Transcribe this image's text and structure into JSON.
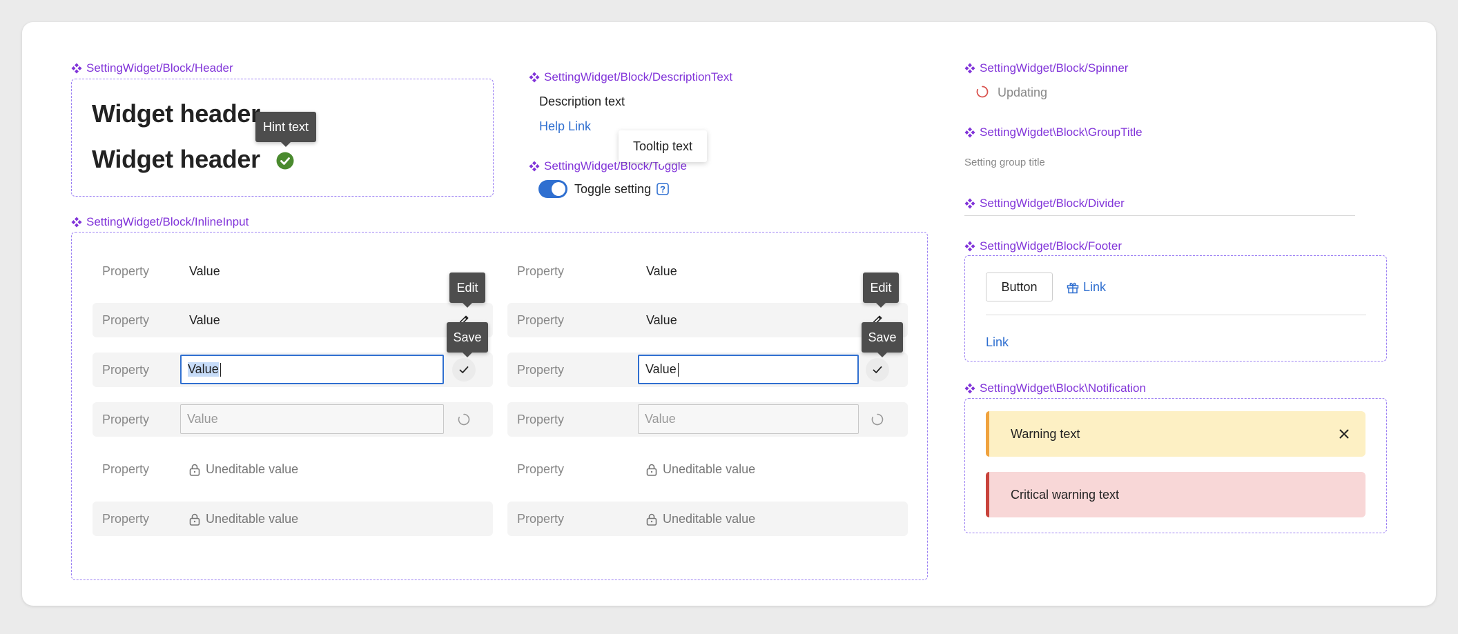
{
  "colors": {
    "component_label": "#8134d9",
    "dashed_border": "#9b7ff3",
    "accent_blue": "#2f6fd0",
    "success_green": "#4a8a2e",
    "warning_bg": "#fdf0c4",
    "warning_bar": "#f0a23d",
    "critical_bg": "#f8d7d7",
    "critical_bar": "#c8423b",
    "spinner_red": "#d9534f"
  },
  "header_block": {
    "component_label": "SettingWidget/Block/Header",
    "title_1": "Widget header",
    "title_2": "Widget header",
    "hint_tooltip": "Hint text",
    "status_icon": "check-circle-icon"
  },
  "description_block": {
    "component_label": "SettingWidget/Block/DescriptionText",
    "description": "Description text",
    "help_link": "Help Link"
  },
  "toggle_block": {
    "component_label": "SettingWidget/Block/Toggle",
    "tooltip": "Tooltip text",
    "label": "Toggle setting",
    "help_icon": "question-icon",
    "enabled": true
  },
  "inline_input": {
    "component_label": "SettingWidget/Block/InlineInput",
    "edit_tooltip": "Edit",
    "save_tooltip": "Save",
    "columns": [
      {
        "rows": [
          {
            "property": "Property",
            "value": "Value",
            "state": "static"
          },
          {
            "property": "Property",
            "value": "Value",
            "state": "hover"
          },
          {
            "property": "Property",
            "value": "Value",
            "state": "editing"
          },
          {
            "property": "Property",
            "value": "Value",
            "state": "saving"
          },
          {
            "property": "Property",
            "value": "Uneditable value",
            "state": "locked"
          },
          {
            "property": "Property",
            "value": "Uneditable value",
            "state": "locked-hover"
          }
        ]
      },
      {
        "rows": [
          {
            "property": "Property",
            "value": "Value",
            "state": "static"
          },
          {
            "property": "Property",
            "value": "Value",
            "state": "hover"
          },
          {
            "property": "Property",
            "value": "Value",
            "state": "editing"
          },
          {
            "property": "Property",
            "value": "Value",
            "state": "saving"
          },
          {
            "property": "Property",
            "value": "Uneditable value",
            "state": "locked"
          },
          {
            "property": "Property",
            "value": "Uneditable value",
            "state": "locked-hover"
          }
        ]
      }
    ]
  },
  "spinner_block": {
    "component_label": "SettingWidget/Block/Spinner",
    "text": "Updating"
  },
  "group_title_block": {
    "component_label": "SettingWigdet\\Block\\GroupTitle",
    "title": "Setting group title"
  },
  "divider_block": {
    "component_label": "SettingWidget/Block/Divider"
  },
  "footer_block": {
    "component_label": "SettingWidget/Block/Footer",
    "button_label": "Button",
    "link_with_icon": "Link",
    "link_icon": "gift-icon",
    "link_bottom": "Link"
  },
  "notification_block": {
    "component_label": "SettingWidget\\Block\\Notification",
    "warning_text": "Warning text",
    "critical_text": "Critical warning text"
  }
}
